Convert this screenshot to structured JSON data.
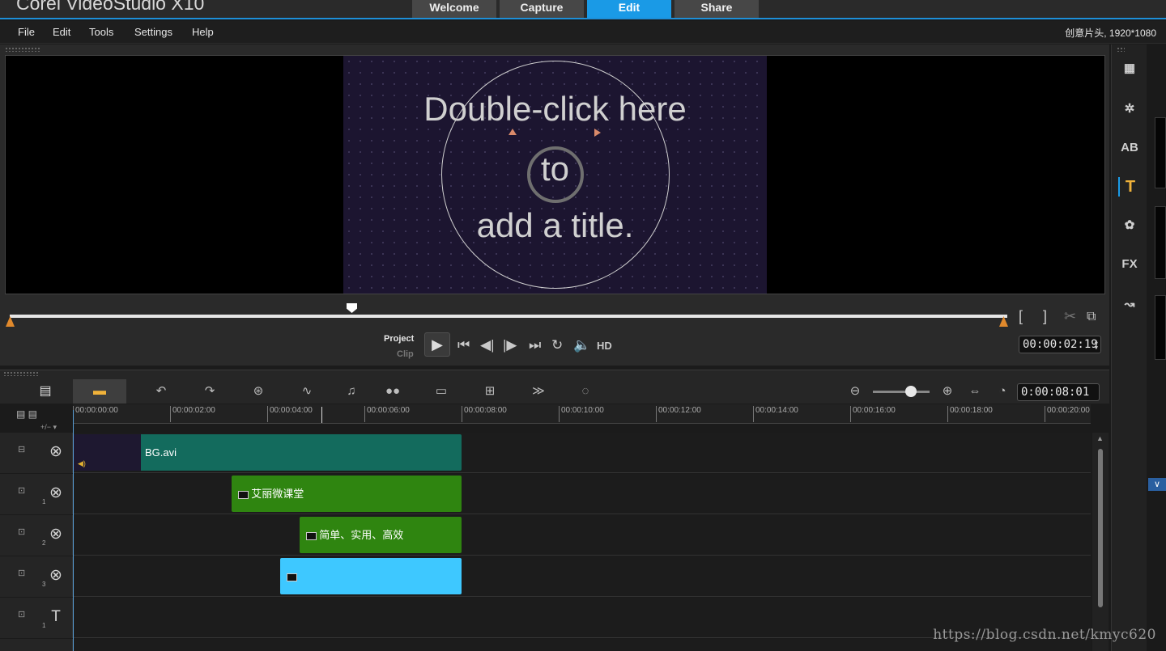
{
  "app": {
    "title": "Corel VideoStudio X10",
    "tabs": [
      {
        "label": "Welcome",
        "active": false
      },
      {
        "label": "Capture",
        "active": false
      },
      {
        "label": "Edit",
        "active": true
      },
      {
        "label": "Share",
        "active": false
      }
    ],
    "menu": [
      "File",
      "Edit",
      "Tools",
      "Settings",
      "Help"
    ],
    "project_info": "创意片头, 1920*1080",
    "accent_color": "#1a9ae6"
  },
  "preview": {
    "text_line1": "Double-click here",
    "text_line2": "to",
    "text_line3": "add a title.",
    "mode_project": "Project",
    "mode_clip": "Clip",
    "hd_label": "HD",
    "timecode": "00:00:02:19",
    "controls": [
      "play-icon",
      "start-icon",
      "prev-frame-icon",
      "next-frame-icon",
      "end-icon",
      "repeat-icon",
      "volume-icon"
    ],
    "trim_icons": [
      "mark-in-icon",
      "mark-out-icon",
      "split-icon",
      "enlarge-icon"
    ]
  },
  "library": {
    "icons": [
      {
        "name": "media-icon",
        "glyph": "▦"
      },
      {
        "name": "instant-project-icon",
        "glyph": "✲"
      },
      {
        "name": "transition-icon",
        "glyph": "AB"
      },
      {
        "name": "title-icon",
        "glyph": "T",
        "selected": true
      },
      {
        "name": "graphic-icon",
        "glyph": "✿"
      },
      {
        "name": "filter-icon",
        "glyph": "FX"
      },
      {
        "name": "path-icon",
        "glyph": "↝"
      }
    ]
  },
  "timeline": {
    "project_duration": "0:00:08:01",
    "ruler_labels": [
      "00:00:00:00",
      "00:00:02:00",
      "00:00:04:00",
      "00:00:06:00",
      "00:00:08:00",
      "00:00:10:00",
      "00:00:12:00",
      "00:00:14:00",
      "00:00:16:00",
      "00:00:18:00",
      "00:00:20:00"
    ],
    "toolbar_icons": [
      "storyboard-view-icon",
      "timeline-view-icon",
      "undo-icon",
      "redo-icon",
      "record-capture-icon",
      "sound-mixer-icon",
      "auto-music-icon",
      "motion-tracking-icon",
      "subtitle-editor-icon",
      "multi-camera-icon",
      "time-remapping-icon",
      "mask-creator-icon"
    ],
    "tracks": [
      {
        "name": "video-track",
        "clips": [
          {
            "label": "BG.avi",
            "start_sec": 0,
            "end_sec": 8.0,
            "color": "#136b5d"
          }
        ]
      },
      {
        "name": "overlay-track-1",
        "number": "1",
        "clips": [
          {
            "label": "艾丽微课堂",
            "start_sec": 3.27,
            "end_sec": 8.0,
            "color": "#2f8510"
          }
        ]
      },
      {
        "name": "overlay-track-2",
        "number": "2",
        "clips": [
          {
            "label": "简单、实用、高效",
            "start_sec": 4.67,
            "end_sec": 8.0,
            "color": "#2f8510"
          }
        ]
      },
      {
        "name": "overlay-track-3",
        "number": "3",
        "clips": [
          {
            "label": "",
            "start_sec": 4.27,
            "end_sec": 8.0,
            "color": "#3ec8ff"
          }
        ]
      },
      {
        "name": "title-track-1",
        "number": "1",
        "clips": []
      },
      {
        "name": "voice-track",
        "clips": []
      }
    ]
  },
  "watermark": "https://blog.csdn.net/kmyc620"
}
